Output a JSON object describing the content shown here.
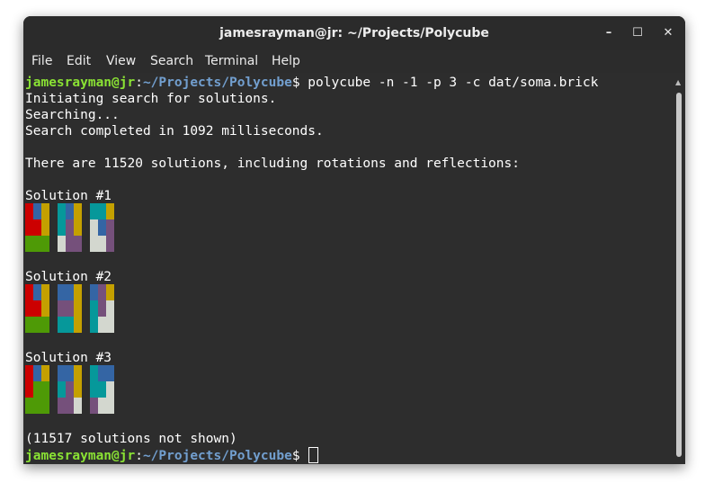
{
  "window": {
    "title": "jamesrayman@jr: ~/Projects/Polycube",
    "controls": {
      "minimize": "–",
      "maximize": "☐",
      "close": "✕"
    }
  },
  "menu": [
    "File",
    "Edit",
    "View",
    "Search",
    "Terminal",
    "Help"
  ],
  "prompt": {
    "user_host": "jamesrayman@jr",
    "sep": ":",
    "path": "~/Projects/Polycube",
    "dollar": "$ "
  },
  "command": "polycube -n -1 -p 3 -c dat/soma.brick",
  "output": {
    "l1": "Initiating search for solutions.",
    "l2": "Searching...",
    "l3": "Search completed in 1092 milliseconds.",
    "l4": "There are 11520 solutions, including rotations and reflections:",
    "footer": "(11517 solutions not shown)"
  },
  "colors": {
    "R": "#cc0000",
    "B": "#3465a4",
    "Y": "#c4a000",
    "G": "#4e9a06",
    "C": "#06989a",
    "P": "#75507b",
    "W": "#d3d7cf",
    "_": "#2d2d2d"
  },
  "solutions": [
    {
      "label": "Solution #1",
      "layers": [
        [
          "RBY",
          "RRY",
          "GGG"
        ],
        [
          "CBY",
          "CPY",
          "WPP"
        ],
        [
          "CCY",
          "WBP",
          "WWP"
        ]
      ]
    },
    {
      "label": "Solution #2",
      "layers": [
        [
          "RBY",
          "RRY",
          "GGG"
        ],
        [
          "BBY",
          "PPY",
          "CCY"
        ],
        [
          "BPY",
          "CPW",
          "CWW"
        ]
      ]
    },
    {
      "label": "Solution #3",
      "layers": [
        [
          "RBY",
          "RGG",
          "GGG"
        ],
        [
          "BBY",
          "CPY",
          "PPW"
        ],
        [
          "CBB",
          "CCW",
          "PWW"
        ]
      ]
    }
  ]
}
